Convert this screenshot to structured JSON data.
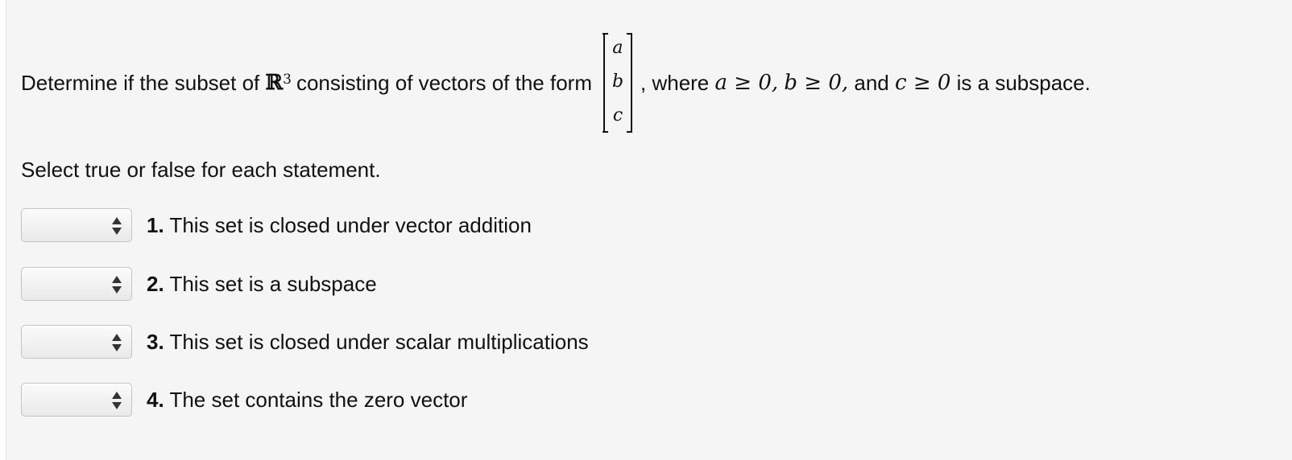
{
  "question": {
    "text_before": "Determine if the subset of",
    "space_symbol": "ℝ",
    "space_exponent": "3",
    "text_mid": "consisting of vectors of the form",
    "vector_entries": [
      "a",
      "b",
      "c"
    ],
    "text_after_comma": ",",
    "text_where": "where",
    "cond_a": "a ≥ 0,",
    "cond_b": "b ≥ 0,",
    "text_and": "and",
    "cond_c": "c ≥ 0",
    "text_end": "is a subspace."
  },
  "instruction": "Select true or false for each statement.",
  "statements": [
    {
      "number": "1.",
      "text": "This set is closed under vector addition",
      "selected": ""
    },
    {
      "number": "2.",
      "text": "This set is a subspace",
      "selected": ""
    },
    {
      "number": "3.",
      "text": "This set is closed under scalar multiplications",
      "selected": ""
    },
    {
      "number": "4.",
      "text": "The set contains the zero vector",
      "selected": ""
    }
  ],
  "icons": {
    "select_arrows": "updown-arrows-icon"
  }
}
